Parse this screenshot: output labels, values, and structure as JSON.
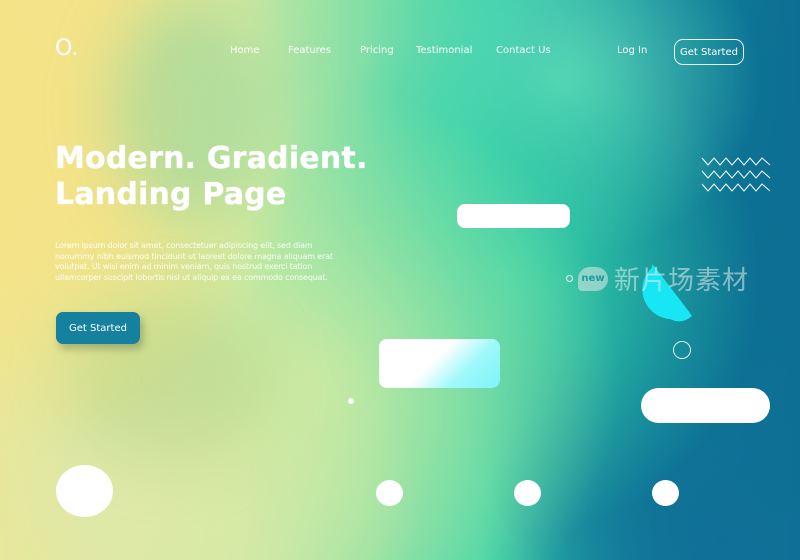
{
  "header": {
    "logo": "O.",
    "nav": [
      {
        "label": "Home"
      },
      {
        "label": "Features"
      },
      {
        "label": "Pricing"
      },
      {
        "label": "Testimonial"
      },
      {
        "label": "Contact Us"
      }
    ],
    "login_label": "Log In",
    "cta_label": "Get Started"
  },
  "hero": {
    "title_line1": "Modern. Gradient.",
    "title_line2": "Landing Page",
    "body": "Lorem ipsum dolor sit amet, consectetuer adipiscing elit, sed diam nonummy nibh euismod tincidunt ut laoreet dolore magna aliquam erat volutpat. Ut wisi enim ad minim veniam, quis nostrud exerci tation ullamcorper suscipit lobortis nisl ut aliquip ex ea commodo consequat.",
    "cta_label": "Get Started"
  },
  "watermark": {
    "badge": "new",
    "text": "新片场素材"
  },
  "colors": {
    "primary_button": "#16809f",
    "accent_cyan": "#18e6f5",
    "gradient_yellow": "#f3e48a",
    "gradient_green": "#38d3a8",
    "gradient_teal": "#0d6e93"
  }
}
